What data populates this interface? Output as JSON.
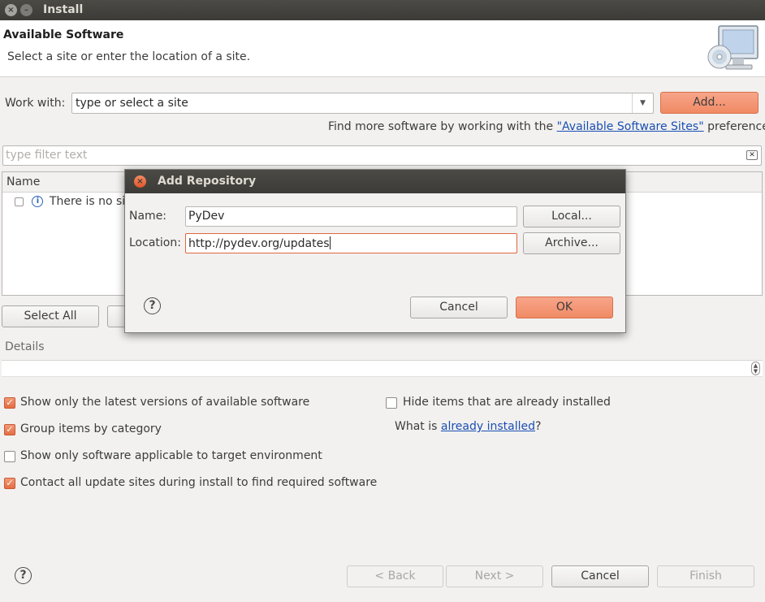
{
  "window": {
    "title": "Install",
    "close_glyph": "×",
    "min_glyph": "–"
  },
  "header": {
    "title": "Available Software",
    "subtitle": "Select a site or enter the location of a site.",
    "icon": "install-monitor-cd-icon"
  },
  "work_with": {
    "label": "Work with:",
    "value": "type or select a site",
    "dropdown_glyph": "▼",
    "add_label": "Add..."
  },
  "find_more": {
    "prefix": "Find more software by working with the ",
    "link": "\"Available Software Sites\"",
    "suffix": " preferences."
  },
  "filter": {
    "placeholder": "type filter text",
    "clear_glyph": "✕"
  },
  "tree": {
    "column_name": "Name",
    "message": "There is no site",
    "info_glyph": "i"
  },
  "buttons_row": {
    "select_all": "Select All"
  },
  "details": {
    "label": "Details",
    "spin_up": "▲",
    "spin_down": "▼"
  },
  "options": [
    {
      "label": "Show only the latest versions of available software",
      "checked": true
    },
    {
      "label": "Group items by category",
      "checked": true
    },
    {
      "label": "Show only software applicable to target environment",
      "checked": false
    },
    {
      "label": "Contact all update sites during install to find required software",
      "checked": true
    },
    {
      "label": "Hide items that are already installed",
      "checked": false
    }
  ],
  "check_glyph": "✓",
  "already_installed": {
    "prefix": "What is ",
    "link": "already installed",
    "suffix": "?"
  },
  "footer": {
    "help_glyph": "?",
    "back": "< Back",
    "next": "Next >",
    "cancel": "Cancel",
    "finish": "Finish"
  },
  "dialog": {
    "title": "Add Repository",
    "close_glyph": "×",
    "name_label": "Name:",
    "name_value": "PyDev",
    "location_label": "Location:",
    "location_value": "http://pydev.org/updates",
    "local_button": "Local...",
    "archive_button": "Archive...",
    "cancel_button": "Cancel",
    "ok_button": "OK",
    "help_glyph": "?"
  },
  "colors": {
    "accent": "#f08a64",
    "titlebar": "#3c3b37",
    "link": "#1a4fb3"
  }
}
